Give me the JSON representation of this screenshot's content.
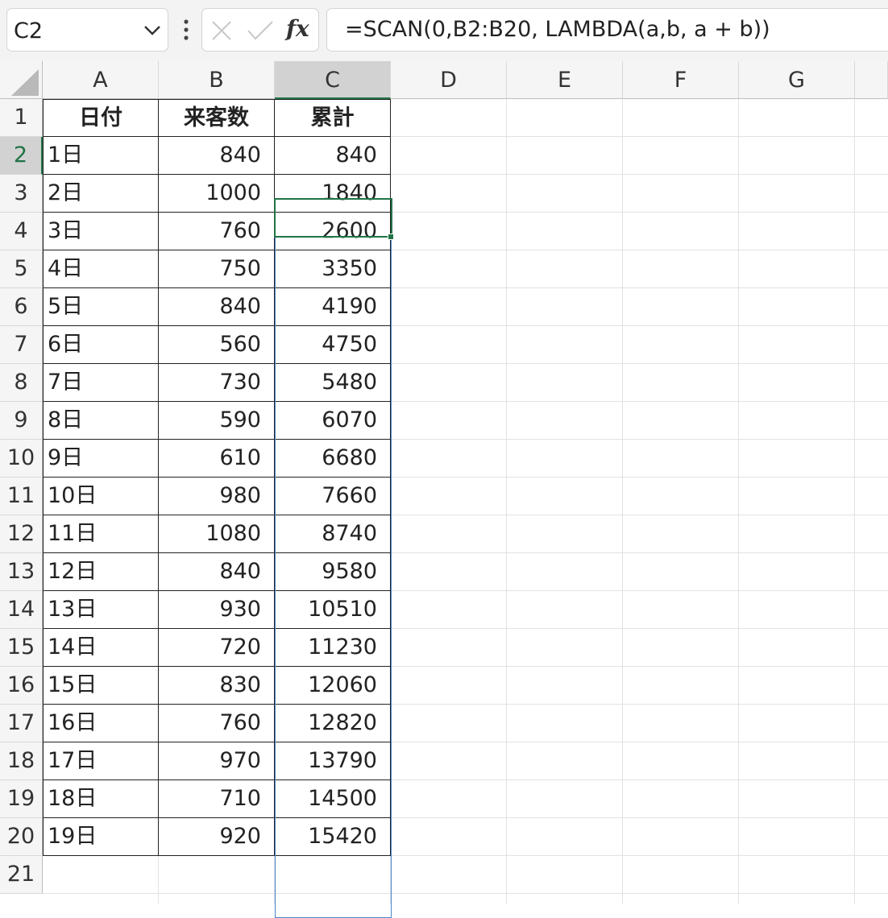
{
  "name_box": {
    "value": "C2"
  },
  "formula_bar": {
    "formula": "=SCAN(0,B2:B20, LAMBDA(a,b, a + b))",
    "fx_label": "fx"
  },
  "icons": [
    "chevron-down-icon",
    "more-vertical-icon",
    "cancel-icon",
    "enter-icon",
    "fx-icon"
  ],
  "columns": [
    "A",
    "B",
    "C",
    "D",
    "E",
    "F",
    "G"
  ],
  "rows": [
    "1",
    "2",
    "3",
    "4",
    "5",
    "6",
    "7",
    "8",
    "9",
    "10",
    "11",
    "12",
    "13",
    "14",
    "15",
    "16",
    "17",
    "18",
    "19",
    "20",
    "21"
  ],
  "active_cell": "C2",
  "table": {
    "headers": [
      "日付",
      "来客数",
      "累計"
    ],
    "rows": [
      [
        "1日",
        "840",
        "840"
      ],
      [
        "2日",
        "1000",
        "1840"
      ],
      [
        "3日",
        "760",
        "2600"
      ],
      [
        "4日",
        "750",
        "3350"
      ],
      [
        "5日",
        "840",
        "4190"
      ],
      [
        "6日",
        "560",
        "4750"
      ],
      [
        "7日",
        "730",
        "5480"
      ],
      [
        "8日",
        "590",
        "6070"
      ],
      [
        "9日",
        "610",
        "6680"
      ],
      [
        "10日",
        "980",
        "7660"
      ],
      [
        "11日",
        "1080",
        "8740"
      ],
      [
        "12日",
        "840",
        "9580"
      ],
      [
        "13日",
        "930",
        "10510"
      ],
      [
        "14日",
        "720",
        "11230"
      ],
      [
        "15日",
        "830",
        "12060"
      ],
      [
        "16日",
        "760",
        "12820"
      ],
      [
        "17日",
        "970",
        "13790"
      ],
      [
        "18日",
        "710",
        "14500"
      ],
      [
        "19日",
        "920",
        "15420"
      ]
    ]
  },
  "colors": {
    "accent": "#217346",
    "spill": "#4a86c8"
  }
}
